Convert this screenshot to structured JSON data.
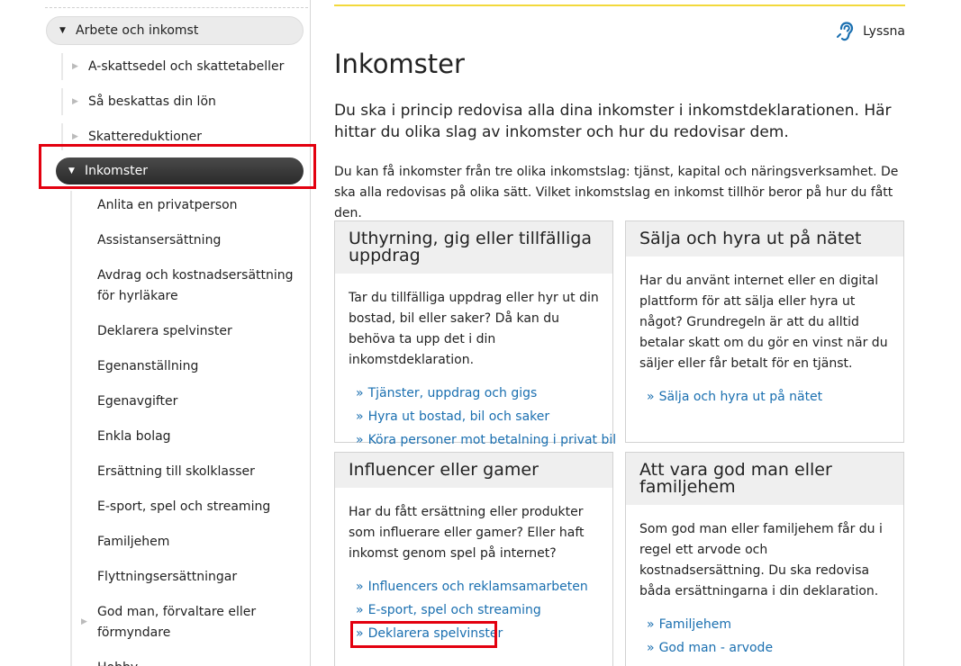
{
  "sidebar": {
    "parent": {
      "label": "Arbete och inkomst"
    },
    "sub_items": [
      {
        "label": "A-skattsedel och skattetabeller"
      },
      {
        "label": "Så beskattas din lön"
      },
      {
        "label": "Skattereduktioner"
      }
    ],
    "active": {
      "label": "Inkomster"
    },
    "children": [
      {
        "label": "Anlita en privatperson"
      },
      {
        "label": "Assistansersättning"
      },
      {
        "label": "Avdrag och kostnadsersättning för hyrläkare"
      },
      {
        "label": "Deklarera spelvinster"
      },
      {
        "label": "Egenanställning"
      },
      {
        "label": "Egenavgifter"
      },
      {
        "label": "Enkla bolag"
      },
      {
        "label": "Ersättning till skolklasser"
      },
      {
        "label": "E-sport, spel och streaming"
      },
      {
        "label": "Familjehem"
      },
      {
        "label": "Flyttningsersättningar"
      },
      {
        "label": "God man, förvaltare eller förmyndare"
      },
      {
        "label": "Hobby"
      }
    ]
  },
  "header": {
    "listen_label": "Lyssna"
  },
  "main": {
    "title": "Inkomster",
    "lead": "Du ska i princip redovisa alla dina inkomster i inkomstdeklarationen. Här hittar du olika slag av inkomster och hur du redovisar dem.",
    "body": "Du kan få inkomster från tre olika inkomstslag: tjänst, kapital och näringsverksamhet. De ska alla redovisas på olika sätt. Vilket inkomstslag en inkomst tillhör beror på hur du fått den."
  },
  "cards": [
    {
      "title": "Uthyrning, gig eller tillfälliga uppdrag",
      "text": "Tar du tillfälliga uppdrag eller hyr ut din bostad, bil eller saker? Då kan du behöva ta upp det i din inkomstdeklaration.",
      "links": [
        "Tjänster, uppdrag och gigs",
        "Hyra ut bostad, bil och saker",
        "Köra personer mot betalning i privat bil"
      ]
    },
    {
      "title": "Sälja och hyra ut på nätet",
      "text": "Har du använt internet eller en digital plattform för att sälja eller hyra ut något? Grundregeln är att du alltid betalar skatt om du gör en vinst när du säljer eller får betalt för en tjänst.",
      "links": [
        "Sälja och hyra ut på nätet"
      ]
    },
    {
      "title": "Influencer eller gamer",
      "text": "Har du fått ersättning eller produkter som influerare eller gamer? Eller haft inkomst genom spel på internet?",
      "links": [
        "Influencers och reklamsamarbeten",
        "E-sport, spel och streaming",
        "Deklarera spelvinster"
      ]
    },
    {
      "title": "Att vara god man eller familjehem",
      "text": "Som god man eller familjehem får du i regel ett arvode och kostnadsersättning. Du ska redovisa båda ersättningarna i din deklaration.",
      "links": [
        "Familjehem",
        "God man - arvode"
      ]
    }
  ],
  "link_marker": "»",
  "colors": {
    "link": "#1a6fb0",
    "highlight": "#e3000f",
    "accent_line": "#f2d93b",
    "active_nav": "#333333"
  },
  "icons": {
    "listen": "ear-icon",
    "expand": "triangle-down-icon",
    "collapsed": "triangle-right-icon"
  }
}
